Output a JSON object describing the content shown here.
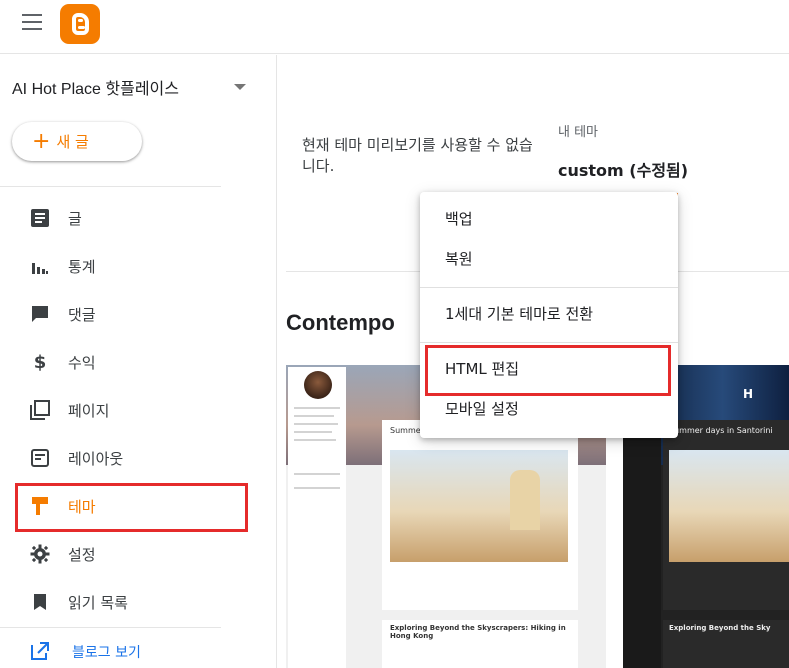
{
  "app": {
    "logo": "blogger-logo",
    "menu_icon": "hamburger-icon"
  },
  "sidebar": {
    "blog_title": "AI Hot Place 핫플레이스",
    "new_post_label": "새 글",
    "items": [
      {
        "label": "글",
        "icon": "posts-icon"
      },
      {
        "label": "통계",
        "icon": "stats-icon"
      },
      {
        "label": "댓글",
        "icon": "comments-icon"
      },
      {
        "label": "수익",
        "icon": "dollar-icon"
      },
      {
        "label": "페이지",
        "icon": "pages-icon"
      },
      {
        "label": "레이아웃",
        "icon": "layout-icon"
      },
      {
        "label": "테마",
        "icon": "theme-icon",
        "active": true
      },
      {
        "label": "설정",
        "icon": "gear-icon"
      },
      {
        "label": "읽기 목록",
        "icon": "bookmark-icon"
      }
    ],
    "view_blog_label": "블로그 보기"
  },
  "main": {
    "preview_message": "현재 테마 미리보기를 사용할 수 없습니다.",
    "my_theme_label": "내 테마",
    "my_theme_name": "custom (수정됨)",
    "theme_section_title": "Contempo"
  },
  "menu": {
    "items": [
      "백업",
      "복원",
      "1세대 기본 테마로 전환",
      "HTML 편집",
      "모바일 설정"
    ]
  },
  "thumbnails": {
    "light": {
      "post1_title": "Summer days in Santorini",
      "post2_title": "Exploring Beyond the Skyscrapers: Hiking in Hong Kong"
    },
    "dark": {
      "post1_title": "Summer days in Santorini",
      "post2_title": "Exploring Beyond the Sky",
      "logo_text": "H"
    }
  },
  "colors": {
    "accent": "#f57c00",
    "highlight": "#e52b2b",
    "link": "#1a73e8"
  }
}
